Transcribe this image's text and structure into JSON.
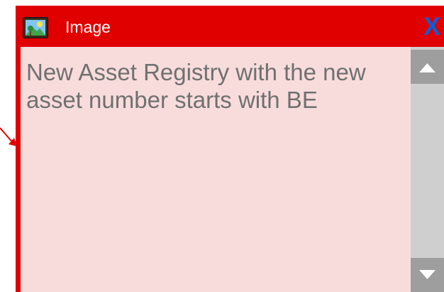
{
  "window": {
    "title": "Image",
    "close_label": "X",
    "title_icon": "image-icon",
    "accent_color": "#e00000",
    "close_color": "#0a5fd8",
    "content_background": "#f8dcdc"
  },
  "content": {
    "text": "New Asset Registry with the new asset number starts with BE"
  },
  "scrollbar": {
    "up_icon": "triangle-up-icon",
    "down_icon": "triangle-down-icon"
  }
}
